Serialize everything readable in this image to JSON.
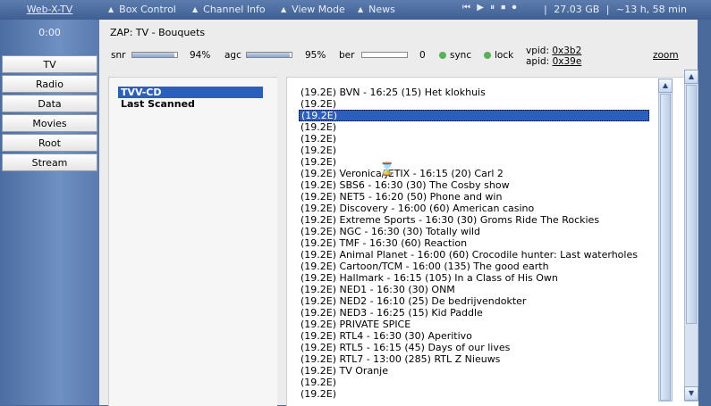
{
  "app": {
    "title": "Web-X-TV"
  },
  "menu": [
    "Box Control",
    "Channel Info",
    "View Mode",
    "News"
  ],
  "controls": [
    "⏮",
    "▶",
    "⏸",
    "⏹",
    "⏺"
  ],
  "stats": {
    "free_space": "27.03 GB",
    "remaining": "~13 h, 58 min"
  },
  "sidebar": {
    "timer": "0:00",
    "items": [
      "TV",
      "Radio",
      "Data",
      "Movies",
      "Root",
      "Stream"
    ]
  },
  "main": {
    "title": "ZAP: TV - Bouquets",
    "signal": {
      "snr_label": "snr",
      "snr_value": "94%",
      "snr_level": 0.94,
      "agc_label": "agc",
      "agc_value": "95%",
      "agc_level": 0.95,
      "ber_label": "ber",
      "ber_value": "0",
      "ber_level": 0,
      "sync_label": "sync",
      "lock_label": "lock",
      "vpid_label": "vpid:",
      "vpid_value": "0x3b2",
      "apid_label": "apid:",
      "apid_value": "0x39e",
      "zoom_label": "zoom"
    },
    "bouquets": [
      {
        "label": "TVV-CD",
        "selected": true
      },
      {
        "label": "Last Scanned",
        "selected": false
      }
    ],
    "channels": [
      {
        "label": "(19.2E) BVN - 16:25 (15) Het klokhuis"
      },
      {
        "label": "(19.2E)"
      },
      {
        "label": "(19.2E)",
        "selected": true
      },
      {
        "label": "(19.2E)"
      },
      {
        "label": "(19.2E)"
      },
      {
        "label": "(19.2E)"
      },
      {
        "label": "(19.2E)"
      },
      {
        "label": "(19.2E) Veronica/JETIX - 16:15 (20) Carl 2"
      },
      {
        "label": "(19.2E) SBS6 - 16:30 (30) The Cosby show"
      },
      {
        "label": "(19.2E) NET5 - 16:20 (50) Phone and win"
      },
      {
        "label": "(19.2E) Discovery - 16:00 (60) American casino"
      },
      {
        "label": "(19.2E) Extreme Sports - 16:30 (30) Groms Ride The Rockies"
      },
      {
        "label": "(19.2E) NGC - 16:30 (30) Totally wild"
      },
      {
        "label": "(19.2E) TMF - 16:30 (60) Reaction"
      },
      {
        "label": "(19.2E) Animal Planet - 16:00 (60) Crocodile hunter: Last waterholes"
      },
      {
        "label": "(19.2E) Cartoon/TCM - 16:00 (135) The good earth"
      },
      {
        "label": "(19.2E) Hallmark - 16:15 (105) In a Class of His Own"
      },
      {
        "label": "(19.2E) NED1 - 16:30 (30) ONM"
      },
      {
        "label": "(19.2E) NED2 - 16:10 (25) De bedrijvendokter"
      },
      {
        "label": "(19.2E) NED3 - 16:25 (15) Kid Paddle"
      },
      {
        "label": "(19.2E) PRIVATE SPICE"
      },
      {
        "label": "(19.2E) RTL4 - 16:30 (30) Aperitivo"
      },
      {
        "label": "(19.2E) RTL5 - 16:15 (45) Days of our lives"
      },
      {
        "label": "(19.2E) RTL7 - 13:00 (285) RTL Z Nieuws"
      },
      {
        "label": "(19.2E) TV Oranje"
      },
      {
        "label": "(19.2E)"
      },
      {
        "label": "(19.2E)"
      }
    ]
  },
  "colors": {
    "accent": "#2b5fbf",
    "background": "#4a6a9c",
    "status_ok": "#59b159"
  },
  "icons": {
    "menu_arrow": "triangle-up-icon",
    "busy": "hourglass-icon"
  }
}
